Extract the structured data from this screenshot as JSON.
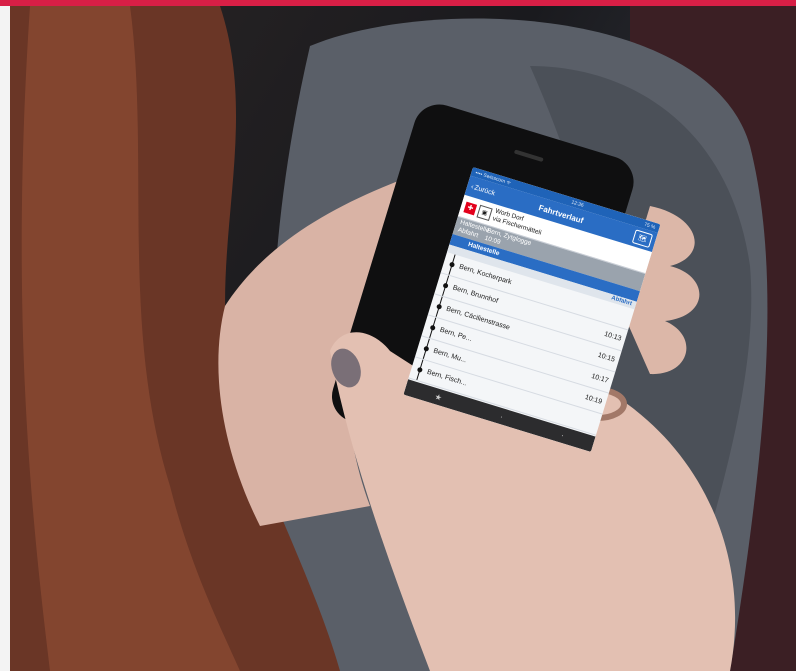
{
  "colors": {
    "accent_bar": "#d81f46",
    "app_blue": "#2a6dc4",
    "sbb_red": "#e3001b"
  },
  "app": {
    "status_bar": {
      "carrier": "•••• Swisscom ᯤ",
      "time": "12:36",
      "battery": "75 %"
    },
    "nav": {
      "back_label": "Zurück",
      "title": "Fahrtverlauf",
      "map_icon": "map-icon"
    },
    "connection": {
      "destination_line1": "Worb Dorf",
      "destination_line2": "via Fischermätteli"
    },
    "departure": {
      "stop_label": "Haltestelle",
      "stop_value": "Bern, Zytglogge",
      "time_label": "Abfahrt",
      "time_value": "10:09"
    },
    "table": {
      "stop_header": "Haltestelle",
      "time_header": "Abfahrt",
      "stops": [
        {
          "name": "Bern, Kocherpark",
          "time": ""
        },
        {
          "name": "Bern, Brunnhof",
          "time": "10:13"
        },
        {
          "name": "Bern, Cäcilienstrasse",
          "time": "10:15"
        },
        {
          "name": "Bern, Pe...",
          "time": "10:17"
        },
        {
          "name": "Bern, Mu...",
          "time": "10:19"
        },
        {
          "name": "Bern, Fisch...",
          "time": ""
        }
      ]
    },
    "tab_bar": {
      "favorite_icon": "star-icon"
    }
  }
}
